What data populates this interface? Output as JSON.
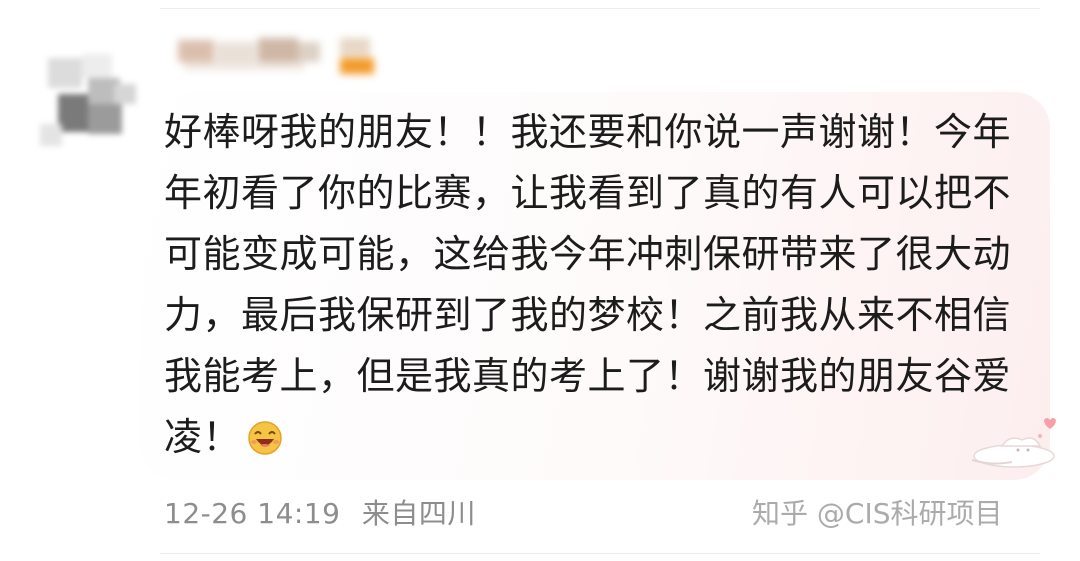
{
  "comment": {
    "text": "好棒呀我的朋友！！我还要和你说一声谢谢！今年年初看了你的比赛，让我看到了真的有人可以把不可能变成可能，这给我今年冲刺保研带来了很大动力，最后我保研到了我的梦校！之前我从来不相信我能考上，但是我真的考上了！谢谢我的朋友谷爱凌！",
    "emoji": "laughing-face-emoji"
  },
  "meta": {
    "time": "12-26 14:19",
    "location": "来自四川"
  },
  "watermark": {
    "text": "知乎 @CIS科研项目"
  },
  "colors": {
    "text": "#1c1c1c",
    "meta": "#8d8d8d",
    "bubble_tint": "#fdeeee"
  }
}
